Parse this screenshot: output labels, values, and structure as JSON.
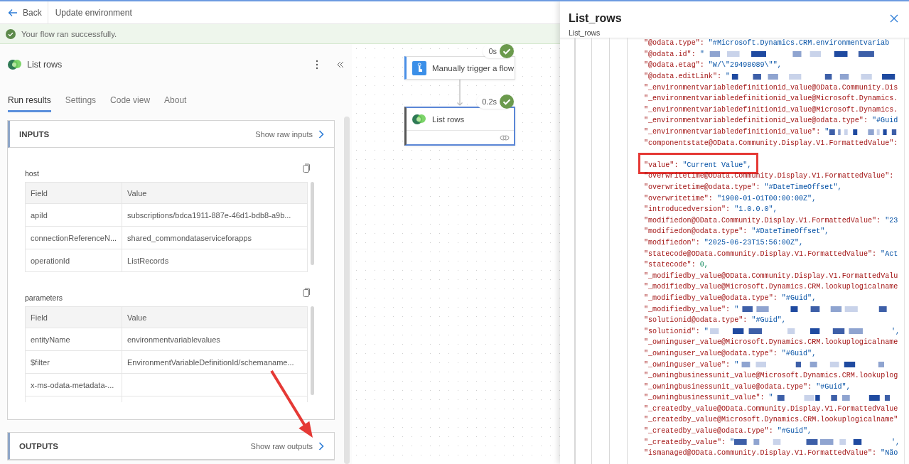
{
  "header": {
    "back_label": "Back",
    "title": "Update environment"
  },
  "banner": {
    "message": "Your flow ran successfully.",
    "succeeded": true
  },
  "action": {
    "title": "List rows"
  },
  "tabs": [
    {
      "label": "Run results",
      "selected": true
    },
    {
      "label": "Settings",
      "selected": false
    },
    {
      "label": "Code view",
      "selected": false
    },
    {
      "label": "About",
      "selected": false
    }
  ],
  "inputs": {
    "title": "INPUTS",
    "link": "Show raw inputs",
    "groups": [
      {
        "label": "host",
        "columns": [
          "Field",
          "Value"
        ],
        "rows": [
          {
            "field": "apiId",
            "value": "subscriptions/bdca1911-887e-46d1-bdb8-a9b..."
          },
          {
            "field": "connectionReferenceN...",
            "value": "shared_commondataserviceforapps"
          },
          {
            "field": "operationId",
            "value": "ListRecords"
          }
        ]
      },
      {
        "label": "parameters",
        "columns": [
          "Field",
          "Value"
        ],
        "rows": [
          {
            "field": "entityName",
            "value": "environmentvariablevalues"
          },
          {
            "field": "$filter",
            "value": "EnvironmentVariableDefinitionId/schemaname..."
          },
          {
            "field": "x-ms-odata-metadata-..."
          }
        ]
      }
    ]
  },
  "outputs": {
    "title": "OUTPUTS",
    "link": "Show raw outputs",
    "arrow_annotation": true
  },
  "canvas": {
    "nodes": [
      {
        "title": "Manually trigger a flow",
        "kind": "trigger",
        "duration": "0s",
        "succeeded": true,
        "selected": false
      },
      {
        "title": "List rows",
        "kind": "dataverse",
        "duration": "0.2s",
        "succeeded": true,
        "selected": true
      }
    ]
  },
  "drawer": {
    "title": "List_rows",
    "subtitle": "List_rows",
    "lines": [
      {
        "kind": "pair",
        "key": "\"@odata.type\":",
        "value": "\"#Microsoft.Dynamics.CRM.environmentvariab",
        "highlighted": false
      },
      {
        "kind": "redacted",
        "key": "\"@odata.id\":",
        "value": "\"",
        "highlighted": false
      },
      {
        "kind": "pair",
        "key": "\"@odata.etag\":",
        "value": "\"W/\\\"29498089\\\"\",",
        "highlighted": false
      },
      {
        "kind": "redacted",
        "key": "\"@odata.editLink\":",
        "value": "\"",
        "highlighted": false
      },
      {
        "kind": "key",
        "key": "\"_environmentvariabledefinitionid_value@OData.Community.Dis",
        "highlighted": false
      },
      {
        "kind": "key",
        "key": "\"_environmentvariabledefinitionid_value@Microsoft.Dynamics.",
        "highlighted": false
      },
      {
        "kind": "key",
        "key": "\"_environmentvariabledefinitionid_value@Microsoft.Dynamics.",
        "highlighted": false
      },
      {
        "kind": "pair",
        "key": "\"_environmentvariabledefinitionid_value@odata.type\":",
        "value": "\"#Guid",
        "highlighted": false
      },
      {
        "kind": "redacted",
        "key": "\"_environmentvariabledefinitionid_value\":",
        "value": "\"",
        "highlighted": false
      },
      {
        "kind": "key",
        "key": "\"componentstate@OData.Community.Display.V1.FormattedValue\":",
        "highlighted": false
      },
      {
        "kind": "covered",
        "highlighted": false
      },
      {
        "kind": "pair",
        "key": "\"value\":",
        "value": "\"Current Value\",",
        "highlighted": true
      },
      {
        "kind": "key",
        "key": "\"overwritetime@OData.Community.Display.V1.FormattedValue\":",
        "highlighted": false
      },
      {
        "kind": "pair",
        "key": "\"overwritetime@odata.type\":",
        "value": "\"#DateTimeOffset\",",
        "highlighted": false
      },
      {
        "kind": "pair",
        "key": "\"overwritetime\":",
        "value": "\"1900-01-01T00:00:00Z\",",
        "highlighted": false
      },
      {
        "kind": "pair",
        "key": "\"introducedversion\":",
        "value": "\"1.0.0.0\",",
        "highlighted": false
      },
      {
        "kind": "pair",
        "key": "\"modifiedon@OData.Community.Display.V1.FormattedValue\":",
        "value": "\"23",
        "highlighted": false
      },
      {
        "kind": "pair",
        "key": "\"modifiedon@odata.type\":",
        "value": "\"#DateTimeOffset\",",
        "highlighted": false
      },
      {
        "kind": "pair",
        "key": "\"modifiedon\":",
        "value": "\"2025-06-23T15:56:00Z\",",
        "highlighted": false
      },
      {
        "kind": "pair",
        "key": "\"statecode@OData.Community.Display.V1.FormattedValue\":",
        "value": "\"Act",
        "highlighted": false
      },
      {
        "kind": "number",
        "key": "\"statecode\":",
        "value": "0,",
        "highlighted": false
      },
      {
        "kind": "key",
        "key": "\"_modifiedby_value@OData.Community.Display.V1.FormattedValu",
        "highlighted": false
      },
      {
        "kind": "key",
        "key": "\"_modifiedby_value@Microsoft.Dynamics.CRM.lookuplogicalname",
        "highlighted": false
      },
      {
        "kind": "pair",
        "key": "\"_modifiedby_value@odata.type\":",
        "value": "\"#Guid\",",
        "highlighted": false
      },
      {
        "kind": "redacted",
        "key": "\"_modifiedby_value\":",
        "value": "\"",
        "highlighted": false
      },
      {
        "kind": "pair",
        "key": "\"solutionid@odata.type\":",
        "value": "\"#Guid\",",
        "highlighted": false
      },
      {
        "kind": "redacted",
        "key": "\"solutionid\":",
        "value": "\"",
        "suffix": "',",
        "highlighted": false
      },
      {
        "kind": "key",
        "key": "\"_owninguser_value@Microsoft.Dynamics.CRM.lookuplogicalname",
        "highlighted": false
      },
      {
        "kind": "pair",
        "key": "\"_owninguser_value@odata.type\":",
        "value": "\"#Guid\",",
        "highlighted": false
      },
      {
        "kind": "redacted",
        "key": "\"_owninguser_value\":",
        "value": "\"",
        "highlighted": false
      },
      {
        "kind": "key",
        "key": "\"_owningbusinessunit_value@Microsoft.Dynamics.CRM.lookuplog",
        "highlighted": false
      },
      {
        "kind": "pair",
        "key": "\"_owningbusinessunit_value@odata.type\":",
        "value": "\"#Guid\",",
        "highlighted": false
      },
      {
        "kind": "redacted",
        "key": "\"_owningbusinessunit_value\":",
        "value": "\"",
        "highlighted": false
      },
      {
        "kind": "key",
        "key": "\"_createdby_value@OData.Community.Display.V1.FormattedValue",
        "highlighted": false
      },
      {
        "kind": "key",
        "key": "\"_createdby_value@Microsoft.Dynamics.CRM.lookuplogicalname\"",
        "highlighted": false
      },
      {
        "kind": "pair",
        "key": "\"_createdby_value@odata.type\":",
        "value": "\"#Guid\",",
        "highlighted": false
      },
      {
        "kind": "redacted",
        "key": "\"_createdby_value\":",
        "value": "\"",
        "suffix": "',",
        "highlighted": false
      },
      {
        "kind": "pair",
        "key": "\"ismanaged@OData.Community.Display.V1.FormattedValue\":",
        "value": "\"Não",
        "highlighted": false
      }
    ]
  }
}
